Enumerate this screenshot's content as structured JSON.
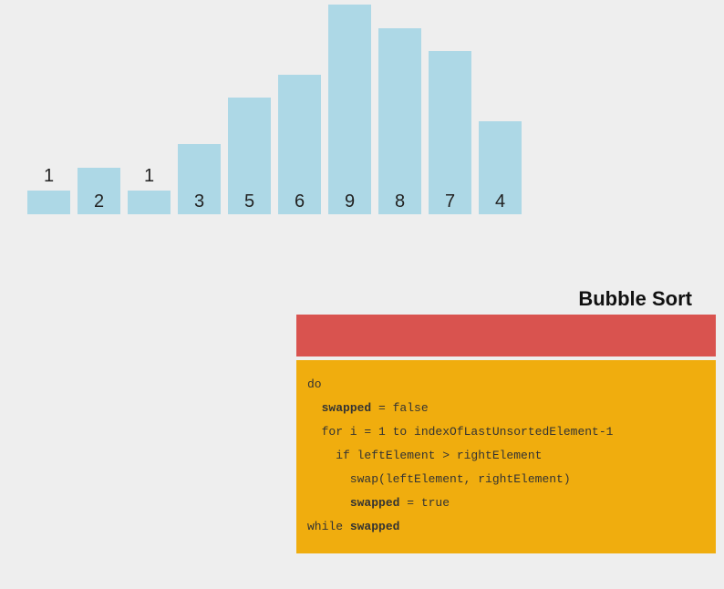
{
  "chart_data": {
    "type": "bar",
    "categories": [
      "1",
      "2",
      "1",
      "3",
      "5",
      "6",
      "9",
      "8",
      "7",
      "4"
    ],
    "values": [
      1,
      2,
      1,
      3,
      5,
      6,
      9,
      8,
      7,
      4
    ],
    "title": "",
    "xlabel": "",
    "ylabel": "",
    "label_positions": [
      "top",
      "inside",
      "top",
      "inside",
      "inside",
      "inside",
      "inside",
      "inside",
      "inside",
      "inside"
    ]
  },
  "algorithm": {
    "title": "Bubble Sort",
    "code": {
      "line0": "do",
      "line1_pre": "  ",
      "line1_kw": "swapped",
      "line1_post": " = false",
      "line2": "  for i = 1 to indexOfLastUnsortedElement-1",
      "line3": "    if leftElement > rightElement",
      "line4": "      swap(leftElement, rightElement)",
      "line5_pre": "      ",
      "line5_kw": "swapped",
      "line5_post": " = true",
      "line6_pre": "while ",
      "line6_kw": "swapped"
    }
  },
  "colors": {
    "bar": "#add8e6",
    "red_banner": "#d9534f",
    "code_bg": "#f0ad0e",
    "page_bg": "#eeeeee"
  }
}
